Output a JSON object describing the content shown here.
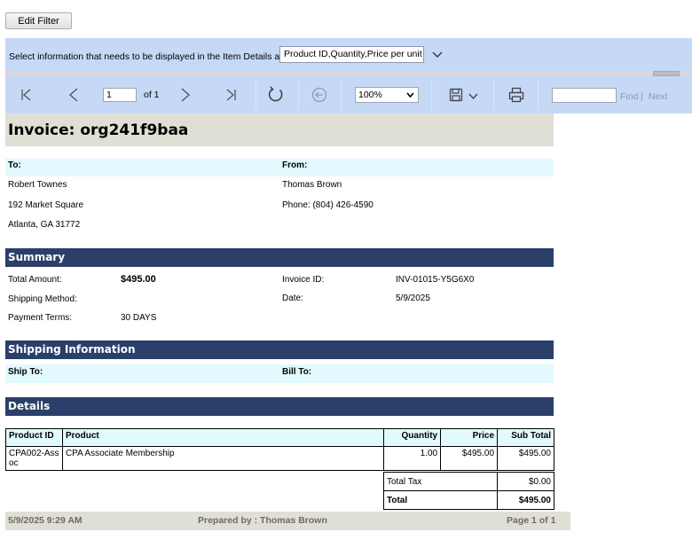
{
  "toolbar_top": {
    "edit_filter_label": "Edit Filter"
  },
  "parameters": {
    "label": "Select information that needs to be displayed in the Item Details area:",
    "selected_value": "Product ID,Quantity,Price per unit"
  },
  "viewer": {
    "current_page": "1",
    "page_of": "of 1",
    "zoom": "100%",
    "find_placeholder": "",
    "find_label": "Find",
    "separator": "|",
    "next_label": "Next"
  },
  "invoice": {
    "title": "Invoice: org241f9baa",
    "to_label": "To:",
    "from_label": "From:",
    "to_name": "Robert Townes",
    "to_address1": "192 Market Square",
    "to_address2": "Atlanta, GA 31772",
    "from_name": "Thomas Brown",
    "from_phone": "Phone: (804) 426-4590"
  },
  "summary": {
    "heading": "Summary",
    "total_amount_label": "Total Amount:",
    "total_amount": "$495.00",
    "shipping_method_label": "Shipping Method:",
    "shipping_method": "",
    "payment_terms_label": "Payment Terms:",
    "payment_terms": "30 DAYS",
    "invoice_id_label": "Invoice ID:",
    "invoice_id": "INV-01015-Y5G6X0",
    "date_label": "Date:",
    "date": "5/9/2025"
  },
  "shipping": {
    "heading": "Shipping Information",
    "ship_to_label": "Ship To:",
    "bill_to_label": "Bill To:"
  },
  "details": {
    "heading": "Details",
    "columns": [
      "Product ID",
      "Product",
      "Quantity",
      "Price",
      "Sub Total"
    ],
    "rows": [
      {
        "product_id": "CPA002-Assoc",
        "product": "CPA Associate Membership",
        "quantity": "1.00",
        "price": "$495.00",
        "sub_total": "$495.00"
      }
    ],
    "total_tax_label": "Total Tax",
    "total_tax": "$0.00",
    "total_label": "Total",
    "total": "$495.00"
  },
  "footer": {
    "timestamp": "5/9/2025 9:29 AM",
    "prepared_by": "Prepared by : Thomas Brown",
    "page": "Page 1 of 1"
  },
  "colors": {
    "toolbar_bg": "#c5d9f7",
    "section_bg": "#2b3f6a",
    "header_cell_bg": "#e2fafd",
    "title_bg": "#e0dfd5"
  }
}
